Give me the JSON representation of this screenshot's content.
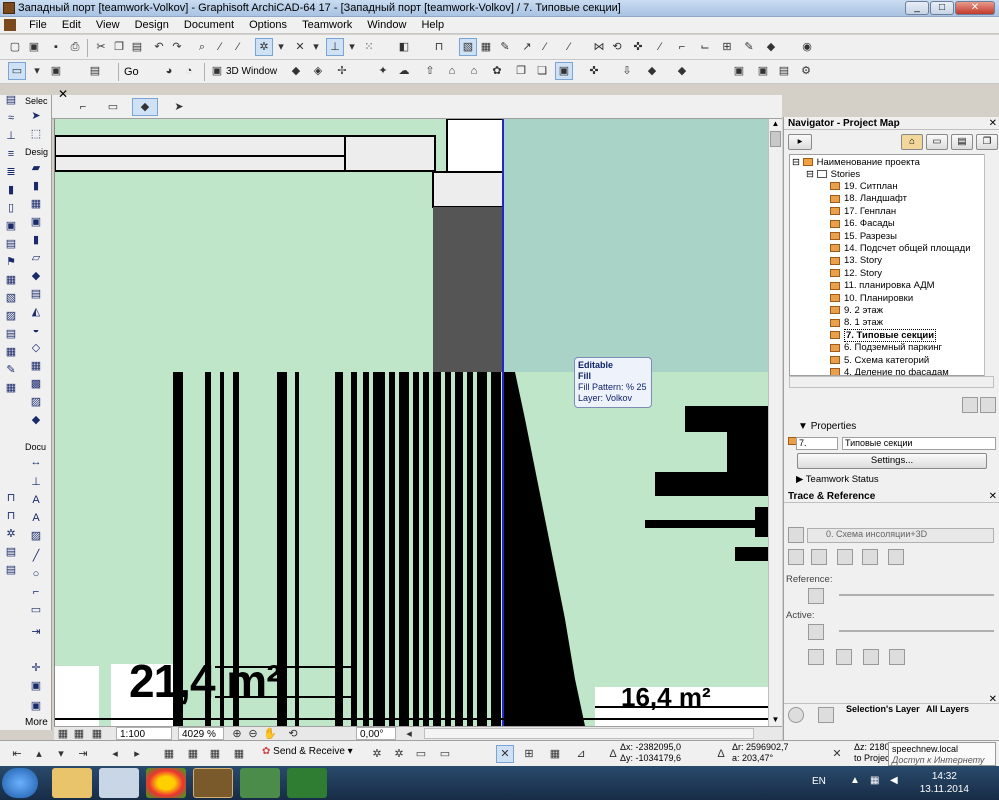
{
  "window": {
    "title": "Западный порт  [teamwork-Volkov] - Graphisoft ArchiCAD-64 17 - [Западный порт  [teamwork-Volkov] / 7. Типовые секции]",
    "min_label": "_",
    "max_label": "□",
    "close_label": "✕"
  },
  "menu": [
    "File",
    "Edit",
    "View",
    "Design",
    "Document",
    "Options",
    "Teamwork",
    "Window",
    "Help"
  ],
  "toolbar2": {
    "go_label": "Go",
    "window_label": "3D Window"
  },
  "toolbox": {
    "select_header": "Selec",
    "design_header": "Desig",
    "document_header": "Docu",
    "more_label": "More"
  },
  "canvas": {
    "area_left": "21,4 m²",
    "area_right": "16,4 m²"
  },
  "tooltip": {
    "title": "Editable",
    "type": "Fill",
    "pattern_label": "Fill Pattern:",
    "pattern_value": "%  25",
    "layer": "Layer: Volkov"
  },
  "statusbar": {
    "scale": "1:100",
    "zoom": "4029 %",
    "angle": "0,00°"
  },
  "navigator": {
    "title": "Navigator - Project Map",
    "root": "Наименование проекта",
    "stories": "Stories",
    "items": [
      "19. Ситплан",
      "18. Ландшафт",
      "17. Генплан",
      "16. Фасады",
      "15. Разрезы",
      "14. Подсчет общей площади",
      "13. Story",
      "12. Story",
      "11. планировка АДМ",
      "10. Планировки",
      "9. 2 этаж",
      "8. 1 этаж",
      "7. Типовые секции",
      "6. Подземный паркинг",
      "5. Схема категорий",
      "4. Деление по фасадам"
    ],
    "selected_index": 12
  },
  "properties": {
    "header": "Properties",
    "id_value": "7.",
    "name_value": "Типовые секции",
    "settings_label": "Settings...",
    "teamwork_status": "Teamwork Status"
  },
  "trace": {
    "title": "Trace & Reference",
    "reference_name": "0. Схема инсоляции+3D",
    "reference_label": "Reference:",
    "active_label": "Active:"
  },
  "layers": {
    "selections_layer": "Selection's Layer",
    "all_layers": "All Layers"
  },
  "bottombar": {
    "send_receive": "Send & Receive",
    "dx": "Δx: -2382095,0",
    "dy": "Δy: -1034179,6",
    "dr": "Δr: 2596902,7",
    "da": "a: 203,47°",
    "dz": "Δz: 2180",
    "to_project": "to Project"
  },
  "taskbar": {
    "lang": "EN",
    "time": "14:32",
    "date": "13.11.2014",
    "tray_title": "speechnew.local",
    "tray_status": "Доступ к Интернету"
  },
  "colors": {
    "canvas_fill": "#bfe6c8",
    "selection_blue": "#2028c8",
    "dark_block": "#555555",
    "accent": "#3a6ea5"
  }
}
